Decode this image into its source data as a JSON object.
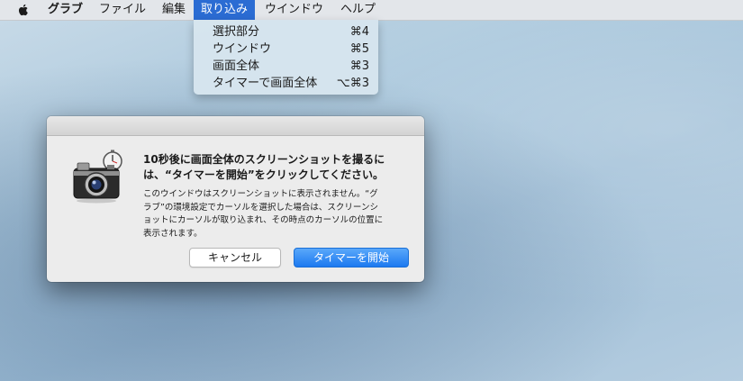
{
  "menubar": {
    "apple_icon": "apple-icon",
    "items": [
      {
        "label": "グラブ"
      },
      {
        "label": "ファイル"
      },
      {
        "label": "編集"
      },
      {
        "label": "取り込み"
      },
      {
        "label": "ウインドウ"
      },
      {
        "label": "ヘルプ"
      }
    ],
    "active_color": "#2b6cd3"
  },
  "capture_menu": {
    "items": [
      {
        "label": "選択部分",
        "shortcut": "⌘4"
      },
      {
        "label": "ウインドウ",
        "shortcut": "⌘5"
      },
      {
        "label": "画面全体",
        "shortcut": "⌘3"
      },
      {
        "label": "タイマーで画面全体",
        "shortcut": "⌥⌘3"
      }
    ]
  },
  "dialog": {
    "icon": "camera-timer-icon",
    "heading_line1": "10秒後に画面全体のスクリーンショットを撮るに",
    "heading_line2": "は、“タイマーを開始”をクリックしてください。",
    "body_line1": "このウインドウはスクリーンショットに表示されません。“グ",
    "body_line2": "ラブ”の環境設定でカーソルを選択した場合は、スクリーンシ",
    "body_line3": "ョットにカーソルが取り込まれ、その時点のカーソルの位置に",
    "body_line4": "表示されます。",
    "cancel_label": "キャンセル",
    "start_label": "タイマーを開始",
    "accent_color": "#1c79f0"
  }
}
